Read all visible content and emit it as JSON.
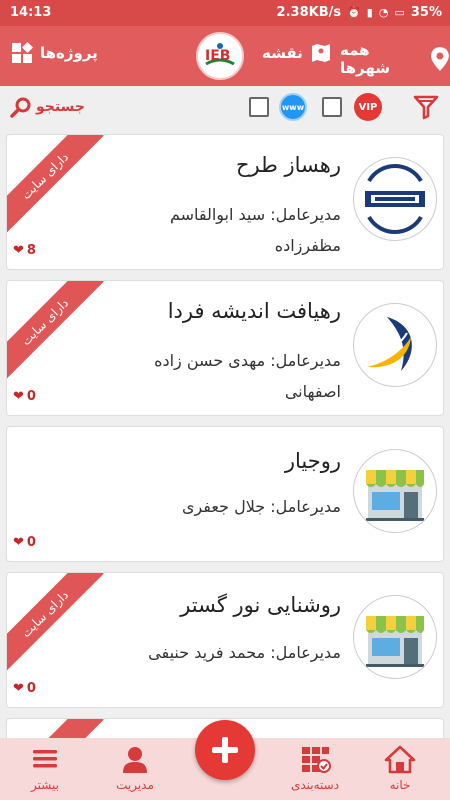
{
  "status_bar": {
    "time": "14:13",
    "speed": "2.38KB/s",
    "battery": "35%"
  },
  "app_bar": {
    "projects_label": "پروژه‌ها",
    "map_label": "نقشه",
    "all_cities_label": "همه شهرها",
    "accent": "#e15c5c"
  },
  "filter_bar": {
    "search_label": "جستجو",
    "vip_label": "VIP",
    "www_label": "www"
  },
  "ribbon_text": "دارای سایت",
  "listings": [
    {
      "name": "رهساز طرح",
      "manager": "مدیرعامل: سید ابوالقاسم مظفرزاده",
      "likes": "8",
      "has_site": true,
      "logo": "rahsaz-tarh-logo"
    },
    {
      "name": "رهیافت اندیشه فردا",
      "manager": "مدیرعامل: مهدی حسن زاده اصفهانی",
      "likes": "0",
      "has_site": true,
      "logo": "rahyaft-logo"
    },
    {
      "name": "روجیار",
      "manager": "مدیرعامل: جلال جعفری",
      "likes": "0",
      "has_site": false,
      "logo": "shop-icon"
    },
    {
      "name": "روشنایی نور گستر",
      "manager": "مدیرعامل: محمد فرید حنیفی",
      "likes": "0",
      "has_site": true,
      "logo": "shop-icon"
    }
  ],
  "bottom_nav": {
    "home": "خانه",
    "categories": "دسته‌بندی",
    "management": "مدیریت",
    "more": "بیشتر"
  }
}
